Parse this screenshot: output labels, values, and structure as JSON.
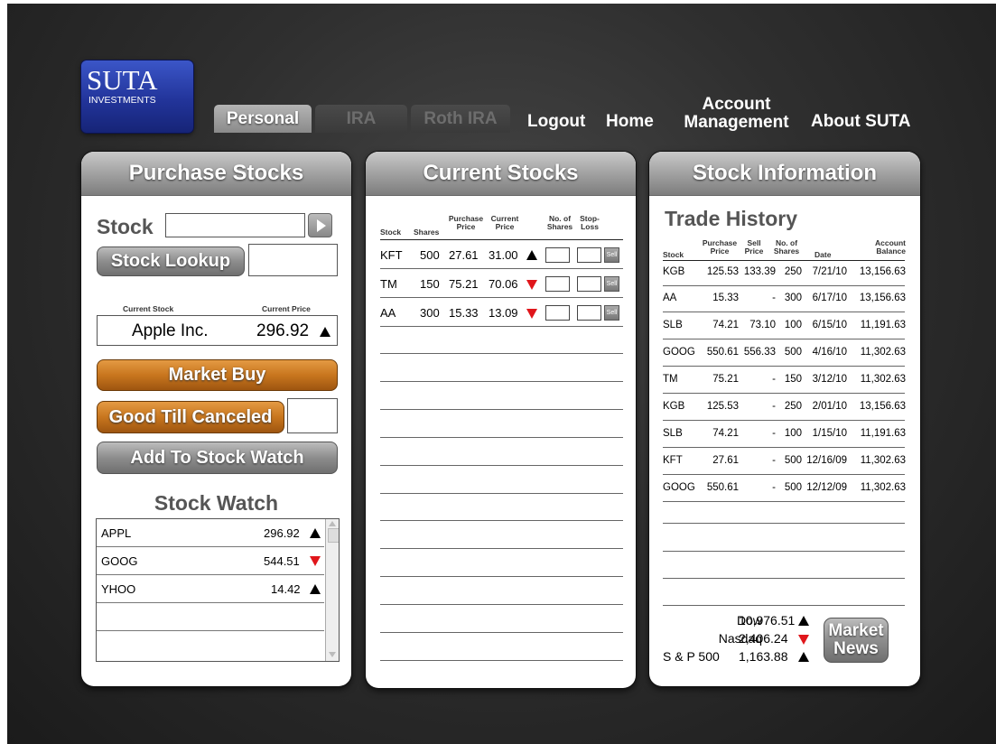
{
  "logo": {
    "title": "SUTA",
    "subtitle": "INVESTMENTS"
  },
  "tabs": [
    {
      "label": "Personal",
      "state": "active"
    },
    {
      "label": "IRA",
      "state": "inactive"
    },
    {
      "label": "Roth IRA",
      "state": "inactive"
    }
  ],
  "nav": {
    "logout": "Logout",
    "home": "Home",
    "account_line1": "Account",
    "account_line2": "Management",
    "about": "About SUTA"
  },
  "purchase": {
    "title": "Purchase Stocks",
    "stock_label": "Stock",
    "stock_value": "",
    "lookup_button": "Stock Lookup",
    "lookup_value": "",
    "current_stock_header": "Current Stock",
    "current_price_header": "Current Price",
    "current_stock": "Apple Inc.",
    "current_price": "296.92",
    "current_trend": "up",
    "market_buy": "Market Buy",
    "good_till": "Good Till Canceled",
    "good_till_value": "",
    "add_watch": "Add To Stock Watch"
  },
  "watch": {
    "title": "Stock Watch",
    "rows": [
      {
        "symbol": "APPL",
        "price": "296.92",
        "trend": "up"
      },
      {
        "symbol": "GOOG",
        "price": "544.51",
        "trend": "down"
      },
      {
        "symbol": "YHOO",
        "price": "14.42",
        "trend": "up"
      }
    ]
  },
  "current": {
    "title": "Current Stocks",
    "headers": {
      "stock": "Stock",
      "shares": "Shares",
      "purchase_1": "Purchase",
      "purchase_2": "Price",
      "current_1": "Current",
      "current_2": "Price",
      "noshares_1": "No. of",
      "noshares_2": "Shares",
      "stop_1": "Stop-",
      "stop_2": "Loss"
    },
    "sell_label": "Sell",
    "rows": [
      {
        "stock": "KFT",
        "shares": "500",
        "purchase": "27.61",
        "current": "31.00",
        "trend": "up"
      },
      {
        "stock": "TM",
        "shares": "150",
        "purchase": "75.21",
        "current": "70.06",
        "trend": "down"
      },
      {
        "stock": "AA",
        "shares": "300",
        "purchase": "15.33",
        "current": "13.09",
        "trend": "down"
      }
    ]
  },
  "info": {
    "title": "Stock Information",
    "history_title": "Trade History",
    "headers": {
      "stock": "Stock",
      "purchase_1": "Purchase",
      "purchase_2": "Price",
      "sell_1": "Sell",
      "sell_2": "Price",
      "noshares_1": "No. of",
      "noshares_2": "Shares",
      "date": "Date",
      "balance_1": "Account",
      "balance_2": "Balance"
    },
    "rows": [
      {
        "stock": "KGB",
        "purchase": "125.53",
        "sell": "133.39",
        "shares": "250",
        "date": "7/21/10",
        "balance": "13,156.63"
      },
      {
        "stock": "AA",
        "purchase": "15.33",
        "sell": "-",
        "shares": "300",
        "date": "6/17/10",
        "balance": "13,156.63"
      },
      {
        "stock": "SLB",
        "purchase": "74.21",
        "sell": "73.10",
        "shares": "100",
        "date": "6/15/10",
        "balance": "11,191.63"
      },
      {
        "stock": "GOOG",
        "purchase": "550.61",
        "sell": "556.33",
        "shares": "500",
        "date": "4/16/10",
        "balance": "11,302.63"
      },
      {
        "stock": "TM",
        "purchase": "75.21",
        "sell": "-",
        "shares": "150",
        "date": "3/12/10",
        "balance": "11,302.63"
      },
      {
        "stock": "KGB",
        "purchase": "125.53",
        "sell": "-",
        "shares": "250",
        "date": "2/01/10",
        "balance": "13,156.63"
      },
      {
        "stock": "SLB",
        "purchase": "74.21",
        "sell": "-",
        "shares": "100",
        "date": "1/15/10",
        "balance": "11,191.63"
      },
      {
        "stock": "KFT",
        "purchase": "27.61",
        "sell": "-",
        "shares": "500",
        "date": "12/16/09",
        "balance": "11,302.63"
      },
      {
        "stock": "GOOG",
        "purchase": "550.61",
        "sell": "-",
        "shares": "500",
        "date": "12/12/09",
        "balance": "11,302.63"
      }
    ],
    "indices": [
      {
        "name": "Dow",
        "value": "10,976.51",
        "trend": "up"
      },
      {
        "name": "Nasdaq",
        "value": "2,406.24",
        "trend": "down"
      },
      {
        "name": "S & P 500",
        "value": "1,163.88",
        "trend": "up"
      }
    ],
    "news_line1": "Market",
    "news_line2": "News"
  },
  "colors": {
    "up": "#000000",
    "down": "#e0161b",
    "logo": "#22349a",
    "orange": "#c8761e"
  }
}
